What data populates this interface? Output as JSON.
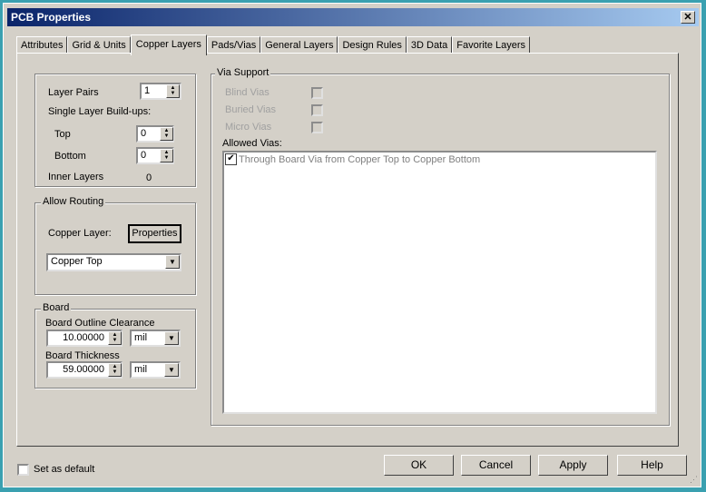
{
  "window": {
    "title": "PCB Properties",
    "close": "✕"
  },
  "tabs": [
    "Attributes",
    "Grid & Units",
    "Copper Layers",
    "Pads/Vias",
    "General Layers",
    "Design Rules",
    "3D Data",
    "Favorite Layers"
  ],
  "active_tab": "Copper Layers",
  "layers": {
    "layer_pairs_label": "Layer Pairs",
    "layer_pairs": "1",
    "single_label": "Single Layer Build-ups:",
    "top_label": "Top",
    "top": "0",
    "bottom_label": "Bottom",
    "bottom": "0",
    "inner_label": "Inner Layers",
    "inner": "0"
  },
  "routing": {
    "title": "Allow Routing",
    "copper_label": "Copper Layer:",
    "properties": "Properties",
    "layer": "Copper Top"
  },
  "board": {
    "title": "Board",
    "clearance_label": "Board Outline Clearance",
    "clearance": "10.00000",
    "clearance_unit": "mil",
    "thickness_label": "Board Thickness",
    "thickness": "59.00000",
    "thickness_unit": "mil"
  },
  "via": {
    "title": "Via Support",
    "blind": "Blind Vias",
    "buried": "Buried Vias",
    "micro": "Micro Vias",
    "allowed_label": "Allowed Vias:",
    "allowed": [
      {
        "label": "Through Board Via from Copper Top to Copper Bottom",
        "checked": true
      }
    ]
  },
  "footer": {
    "default_label": "Set as default",
    "ok": "OK",
    "cancel": "Cancel",
    "apply": "Apply",
    "help": "Help"
  }
}
